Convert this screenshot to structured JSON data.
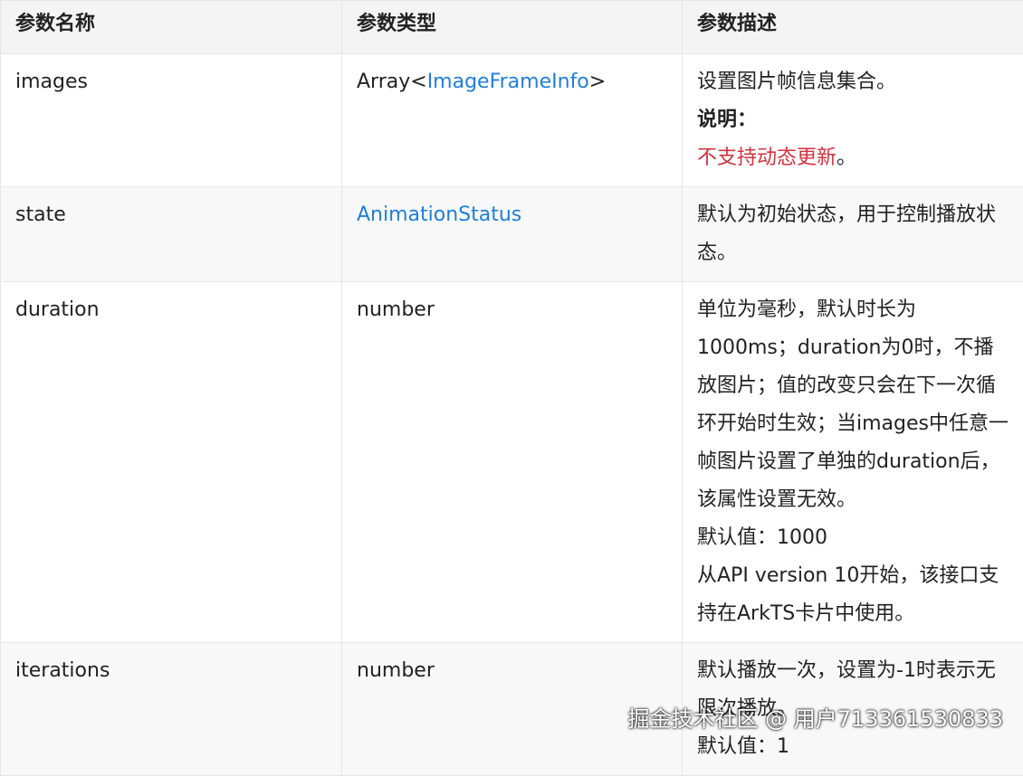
{
  "table": {
    "headers": [
      "参数名称",
      "参数类型",
      "参数描述"
    ],
    "rows": {
      "images": {
        "name": "images",
        "type_prefix": "Array<",
        "type_link": "ImageFrameInfo",
        "type_suffix": ">",
        "desc": "设置图片帧信息集合。",
        "note_label": "说明：",
        "note_text": "不支持动态更新",
        "note_end": "。"
      },
      "state": {
        "name": "state",
        "type_link": "AnimationStatus",
        "desc": "默认为初始状态，用于控制播放状态。"
      },
      "duration": {
        "name": "duration",
        "type": "number",
        "desc_lines": [
          "单位为毫秒，默认时长为1000ms；duration为0时，不播放图片；值的改变只会在下一次循环开始时生效；当images中任意一帧图片设置了单独的duration后，该属性设置无效。",
          "默认值：1000",
          "从API version 10开始，该接口支持在ArkTS卡片中使用。"
        ]
      },
      "iterations": {
        "name": "iterations",
        "type": "number",
        "desc_lines": [
          "默认播放一次，设置为-1时表示无限次播放。",
          "默认值：1"
        ]
      }
    }
  },
  "watermark": "掘金技术社区 @ 用户713361530833",
  "colors": {
    "link": "#1f7fdb",
    "warning": "#d2333f",
    "header_bg": "#f4f4f4",
    "border": "#e6e6e6"
  }
}
